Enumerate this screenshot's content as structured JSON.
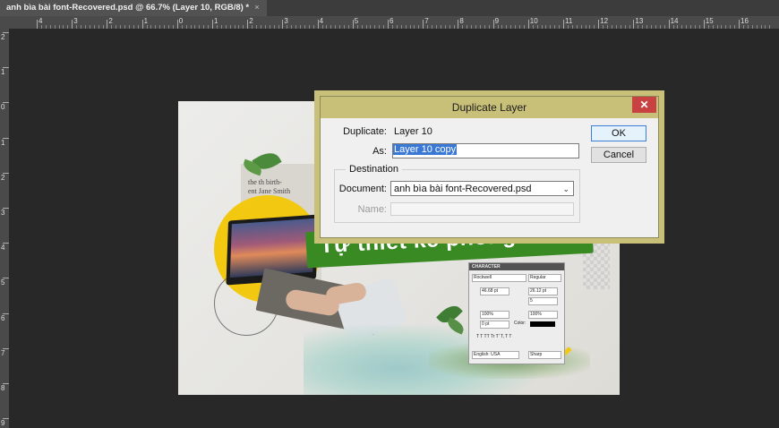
{
  "document_tab": {
    "title": "anh bìa bài font-Recovered.psd @ 66.7% (Layer 10, RGB/8) *",
    "close": "×"
  },
  "ruler": {
    "top_labels": [
      "4",
      "3",
      "2",
      "1",
      "0",
      "1",
      "2",
      "3",
      "4",
      "5",
      "6",
      "7",
      "8",
      "9",
      "10",
      "11",
      "12",
      "13",
      "14",
      "15",
      "16"
    ],
    "left_labels": [
      "2",
      "1",
      "0",
      "1",
      "2",
      "3",
      "4",
      "5",
      "6",
      "7",
      "8",
      "9"
    ]
  },
  "artwork": {
    "banner_text": "Tự thiết kế phông chữ",
    "paper_line1": "the      th birth-",
    "paper_line2": "ent Jane Smith"
  },
  "character_panel": {
    "title": "CHARACTER",
    "font_family": "Rockwell",
    "font_style": "Regular",
    "size": "46.68 pt",
    "leading": "26.12 pt",
    "tracking": "5",
    "vertical_scale": "100%",
    "horizontal_scale": "100%",
    "baseline": "0 pt",
    "color_label": "Color:",
    "language": "English: USA",
    "antialias": "Sharp",
    "type_styles": "T  T  TT  Tr  T'  T,  T  T"
  },
  "dialog": {
    "title": "Duplicate Layer",
    "close_glyph": "✕",
    "duplicate_label": "Duplicate:",
    "duplicate_value": "Layer 10",
    "as_label": "As:",
    "as_value": "Layer 10 copy",
    "ok_label": "OK",
    "cancel_label": "Cancel",
    "destination_legend": "Destination",
    "document_label": "Document:",
    "document_value": "anh bìa bài font-Recovered.psd",
    "name_label": "Name:",
    "name_value": ""
  },
  "colors": {
    "dialog_frame": "#c8bf78",
    "close_button": "#c94242",
    "banner_green": "#3a8a24",
    "accent_yellow": "#f2c811",
    "selection_blue": "#3a78d6"
  }
}
